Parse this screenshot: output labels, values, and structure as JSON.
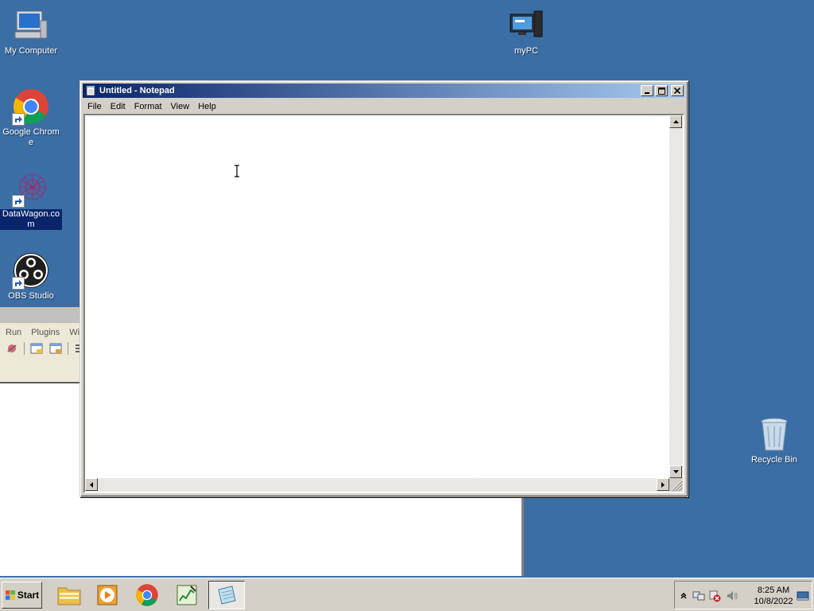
{
  "desktop": {
    "icons": {
      "my_computer": "My Computer",
      "mypc": "myPC",
      "chrome": "Google Chrome",
      "datawagon": "DataWagon.com",
      "obs": "OBS Studio",
      "recycle": "Recycle Bin"
    }
  },
  "background_app": {
    "menu": [
      "Run",
      "Plugins",
      "Wi"
    ]
  },
  "notepad": {
    "title": "Untitled - Notepad",
    "menu": [
      "File",
      "Edit",
      "Format",
      "View",
      "Help"
    ],
    "content": ""
  },
  "taskbar": {
    "start_label": "Start",
    "clock_time": "8:25 AM",
    "clock_date": "10/8/2022"
  },
  "colors": {
    "desktop": "#3a6ea5",
    "title_active_start": "#0a246a",
    "title_active_end": "#a6caf0",
    "chrome_face": "#d4d0c8"
  }
}
